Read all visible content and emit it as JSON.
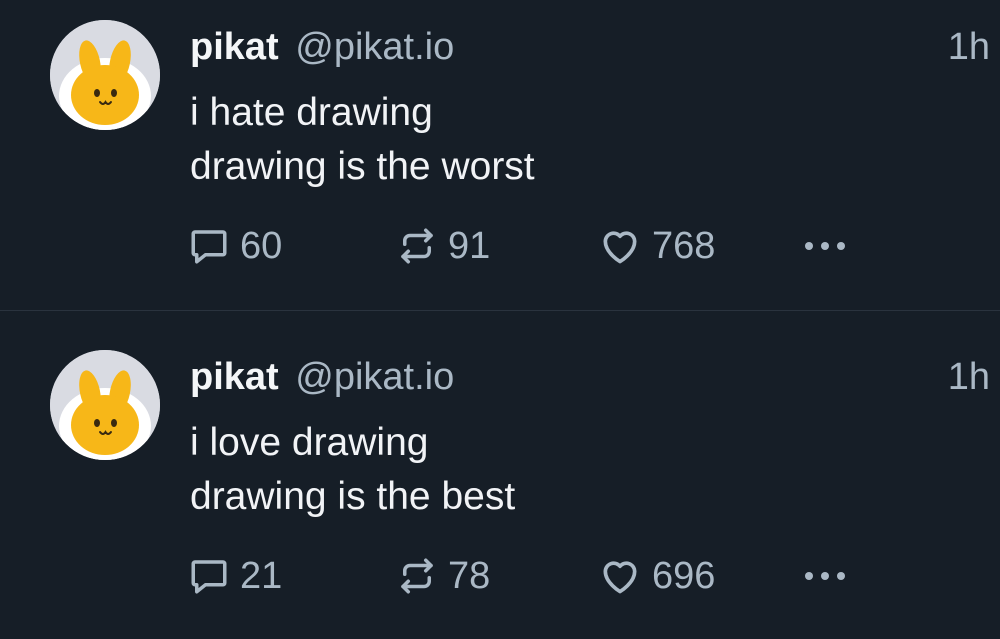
{
  "posts": [
    {
      "author": {
        "name": "pikat",
        "handle": "@pikat.io"
      },
      "time": "1h",
      "text": [
        "i hate drawing",
        "drawing is the worst"
      ],
      "counts": {
        "replies": "60",
        "reposts": "91",
        "likes": "768"
      }
    },
    {
      "author": {
        "name": "pikat",
        "handle": "@pikat.io"
      },
      "time": "1h",
      "text": [
        "i love drawing",
        "drawing is the best"
      ],
      "counts": {
        "replies": "21",
        "reposts": "78",
        "likes": "696"
      }
    }
  ],
  "icons": {
    "avatar": "yellow-bunny-avatar-icon",
    "reply": "speech-bubble-icon",
    "repost": "repost-arrows-icon",
    "like": "heart-icon",
    "more": "more-dots-icon"
  },
  "colors": {
    "background": "#161e27",
    "text": "#f1f3f6",
    "muted": "#aab8c5",
    "divider": "#2a333e",
    "avatar_yellow": "#f7b718"
  }
}
